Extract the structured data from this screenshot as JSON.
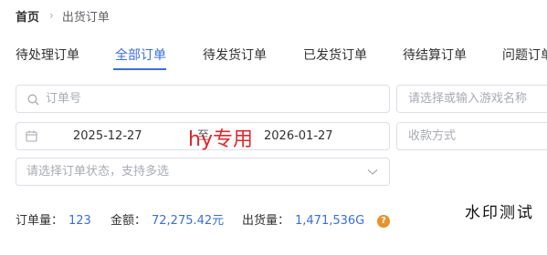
{
  "breadcrumb": {
    "home": "首页",
    "separator": "›",
    "current": "出货订单"
  },
  "tabs": [
    {
      "label": "待处理订单",
      "active": false
    },
    {
      "label": "全部订单",
      "active": true
    },
    {
      "label": "待发货订单",
      "active": false
    },
    {
      "label": "已发货订单",
      "active": false
    },
    {
      "label": "待结算订单",
      "active": false
    },
    {
      "label": "问题订单",
      "active": false
    }
  ],
  "filters": {
    "order_no": {
      "placeholder": "订单号",
      "icon": "search-icon"
    },
    "game": {
      "placeholder": "请选择或输入游戏名称"
    },
    "date_range": {
      "start": "2025-12-27",
      "separator": "至",
      "end": "2026-01-27",
      "icon": "calendar-icon"
    },
    "payment": {
      "placeholder": "收款方式"
    },
    "status": {
      "placeholder": "请选择订单状态，支持多选",
      "icon": "chevron-down-icon"
    }
  },
  "overlay_text": "hy专用",
  "summary": {
    "order_count_label": "订单量：",
    "order_count": "123",
    "amount_label": "金额：",
    "amount": "72,275.42元",
    "shipped_label": "出货量：",
    "shipped": "1,471,536G",
    "help_icon": "?"
  },
  "watermark": "水印测试",
  "colors": {
    "accent": "#3a6fd8",
    "stamp": "#e0282e",
    "help": "#e6922c"
  }
}
